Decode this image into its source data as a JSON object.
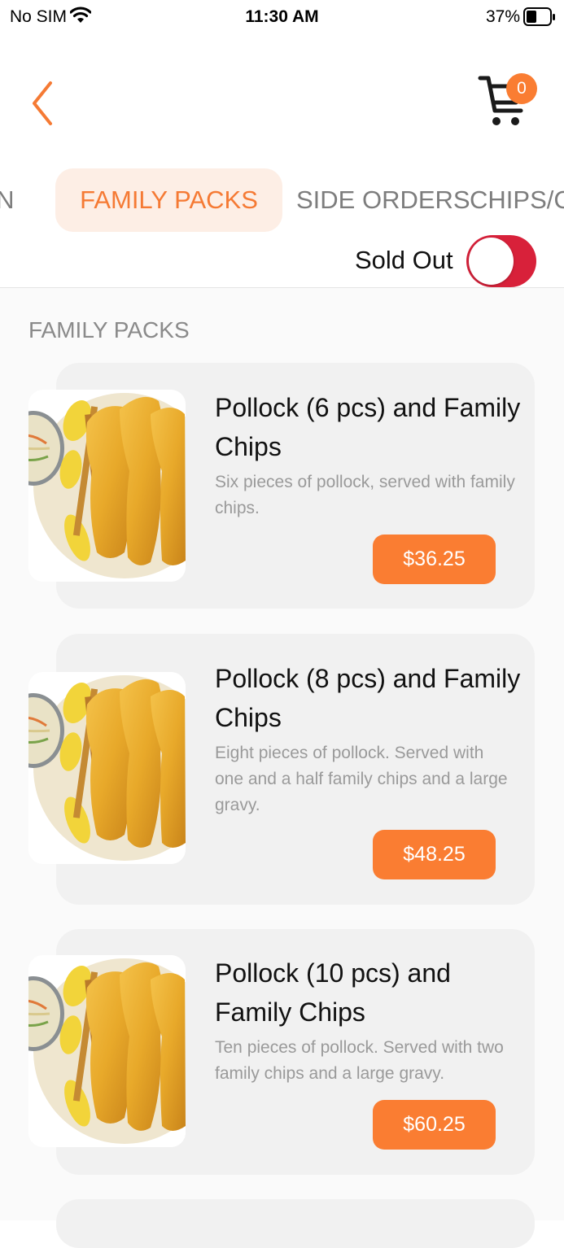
{
  "status_bar": {
    "carrier": "No SIM",
    "time": "11:30 AM",
    "battery": "37%"
  },
  "header": {
    "back_icon": "chevron-left-icon",
    "cart_icon": "cart-icon",
    "cart_count": "0"
  },
  "tabs": [
    {
      "label": "CHICKEN",
      "active": false
    },
    {
      "label": "FAMILY PACKS",
      "active": true
    },
    {
      "label": "SIDE ORDERS",
      "active": false
    },
    {
      "label": "CHIPS/C",
      "active": false
    }
  ],
  "sold_out": {
    "label": "Sold Out",
    "enabled": true
  },
  "section_title": "FAMILY PACKS",
  "items": [
    {
      "name": "Pollock (6 pcs) and Family Chips",
      "description": "Six pieces of pollock, served with family chips.",
      "price": "$36.25"
    },
    {
      "name": "Pollock (8 pcs) and Family Chips",
      "description": "Eight pieces of pollock. Served with one and a half family chips and a large gravy.",
      "price": "$48.25"
    },
    {
      "name": "Pollock (10 pcs) and Family Chips",
      "description": "Ten pieces of pollock. Served with two family chips and a large gravy.",
      "price": "$60.25"
    }
  ],
  "colors": {
    "accent": "#fa7d32",
    "tab_active_bg": "#fdeee5",
    "toggle_on": "#d8213a",
    "card_bg": "#f1f1f1"
  }
}
